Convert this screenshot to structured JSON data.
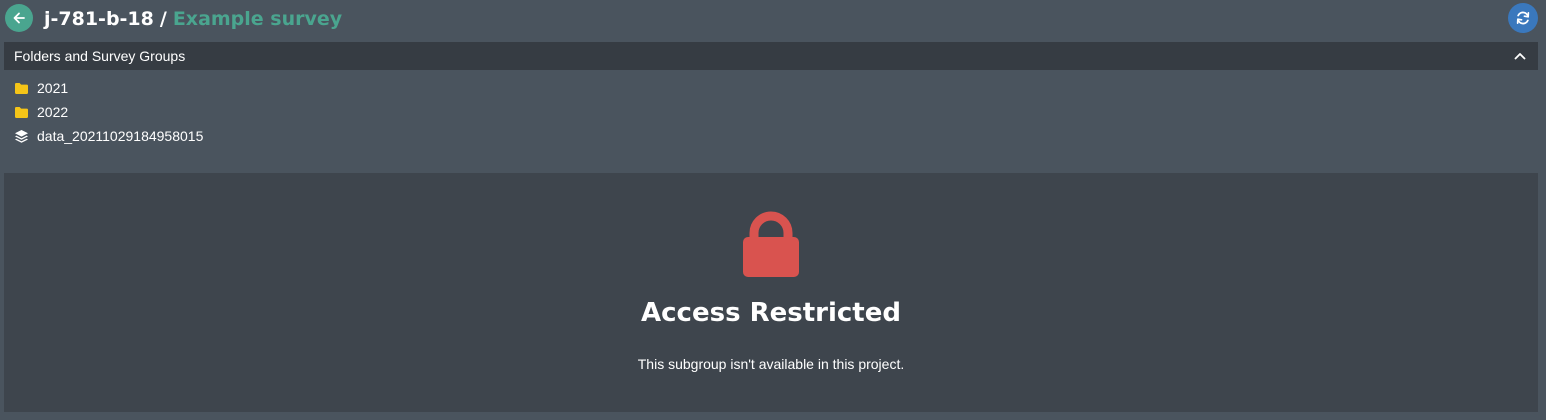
{
  "header": {
    "project": "j-781-b-18",
    "separator": "/",
    "survey": "Example survey",
    "back_icon": "arrow-left-icon",
    "refresh_icon": "refresh-icon"
  },
  "panel": {
    "title": "Folders and Survey Groups",
    "collapse_icon": "chevron-up-icon",
    "items": [
      {
        "label": "2021",
        "icon": "folder-icon"
      },
      {
        "label": "2022",
        "icon": "folder-icon"
      },
      {
        "label": "data_20211029184958015",
        "icon": "layers-icon"
      }
    ]
  },
  "restricted": {
    "icon": "lock-icon",
    "title": "Access Restricted",
    "message": "This subgroup isn't available in this project."
  },
  "colors": {
    "background": "#4a545e",
    "panel_header": "#363c43",
    "restricted_bg": "#3e454d",
    "accent_green": "#4aa58f",
    "accent_blue": "#3a78bd",
    "folder_yellow": "#f5c518",
    "lock_red": "#d9534f"
  }
}
